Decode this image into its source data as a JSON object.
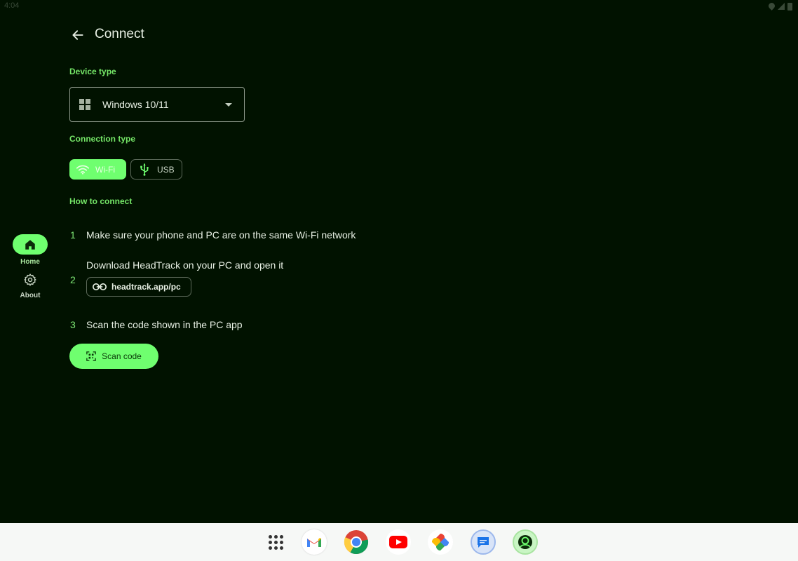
{
  "status_bar": {
    "time": "4:04"
  },
  "nav": {
    "items": [
      {
        "label": "Home",
        "icon": "home-icon",
        "active": true
      },
      {
        "label": "About",
        "icon": "gear-icon",
        "active": false
      }
    ]
  },
  "header": {
    "title": "Connect",
    "back_icon": "arrow-left-icon"
  },
  "device_type": {
    "label": "Device type",
    "selected": "Windows 10/11",
    "icon": "windows-icon"
  },
  "connection_type": {
    "label": "Connection type",
    "options": [
      {
        "label": "Wi-Fi",
        "icon": "wifi-icon",
        "selected": true
      },
      {
        "label": "USB",
        "icon": "usb-icon",
        "selected": false
      }
    ]
  },
  "how_to": {
    "label": "How to connect",
    "steps": [
      {
        "number": "1",
        "text": "Make sure your phone and PC are on the same Wi-Fi network"
      },
      {
        "number": "2",
        "text": "Download HeadTrack on your PC and open it",
        "link": "headtrack.app/pc"
      },
      {
        "number": "3",
        "text": "Scan the code shown in the PC app"
      }
    ],
    "scan_button": "Scan code"
  },
  "taskbar": {
    "apps": [
      "apps-grid-icon",
      "gmail-icon",
      "chrome-icon",
      "youtube-icon",
      "photos-icon",
      "messages-icon",
      "headtrack-icon"
    ]
  },
  "colors": {
    "background": "#011200",
    "accent": "#6fff6f",
    "label_green": "#75e667",
    "taskbar": "#f6f8f6"
  }
}
